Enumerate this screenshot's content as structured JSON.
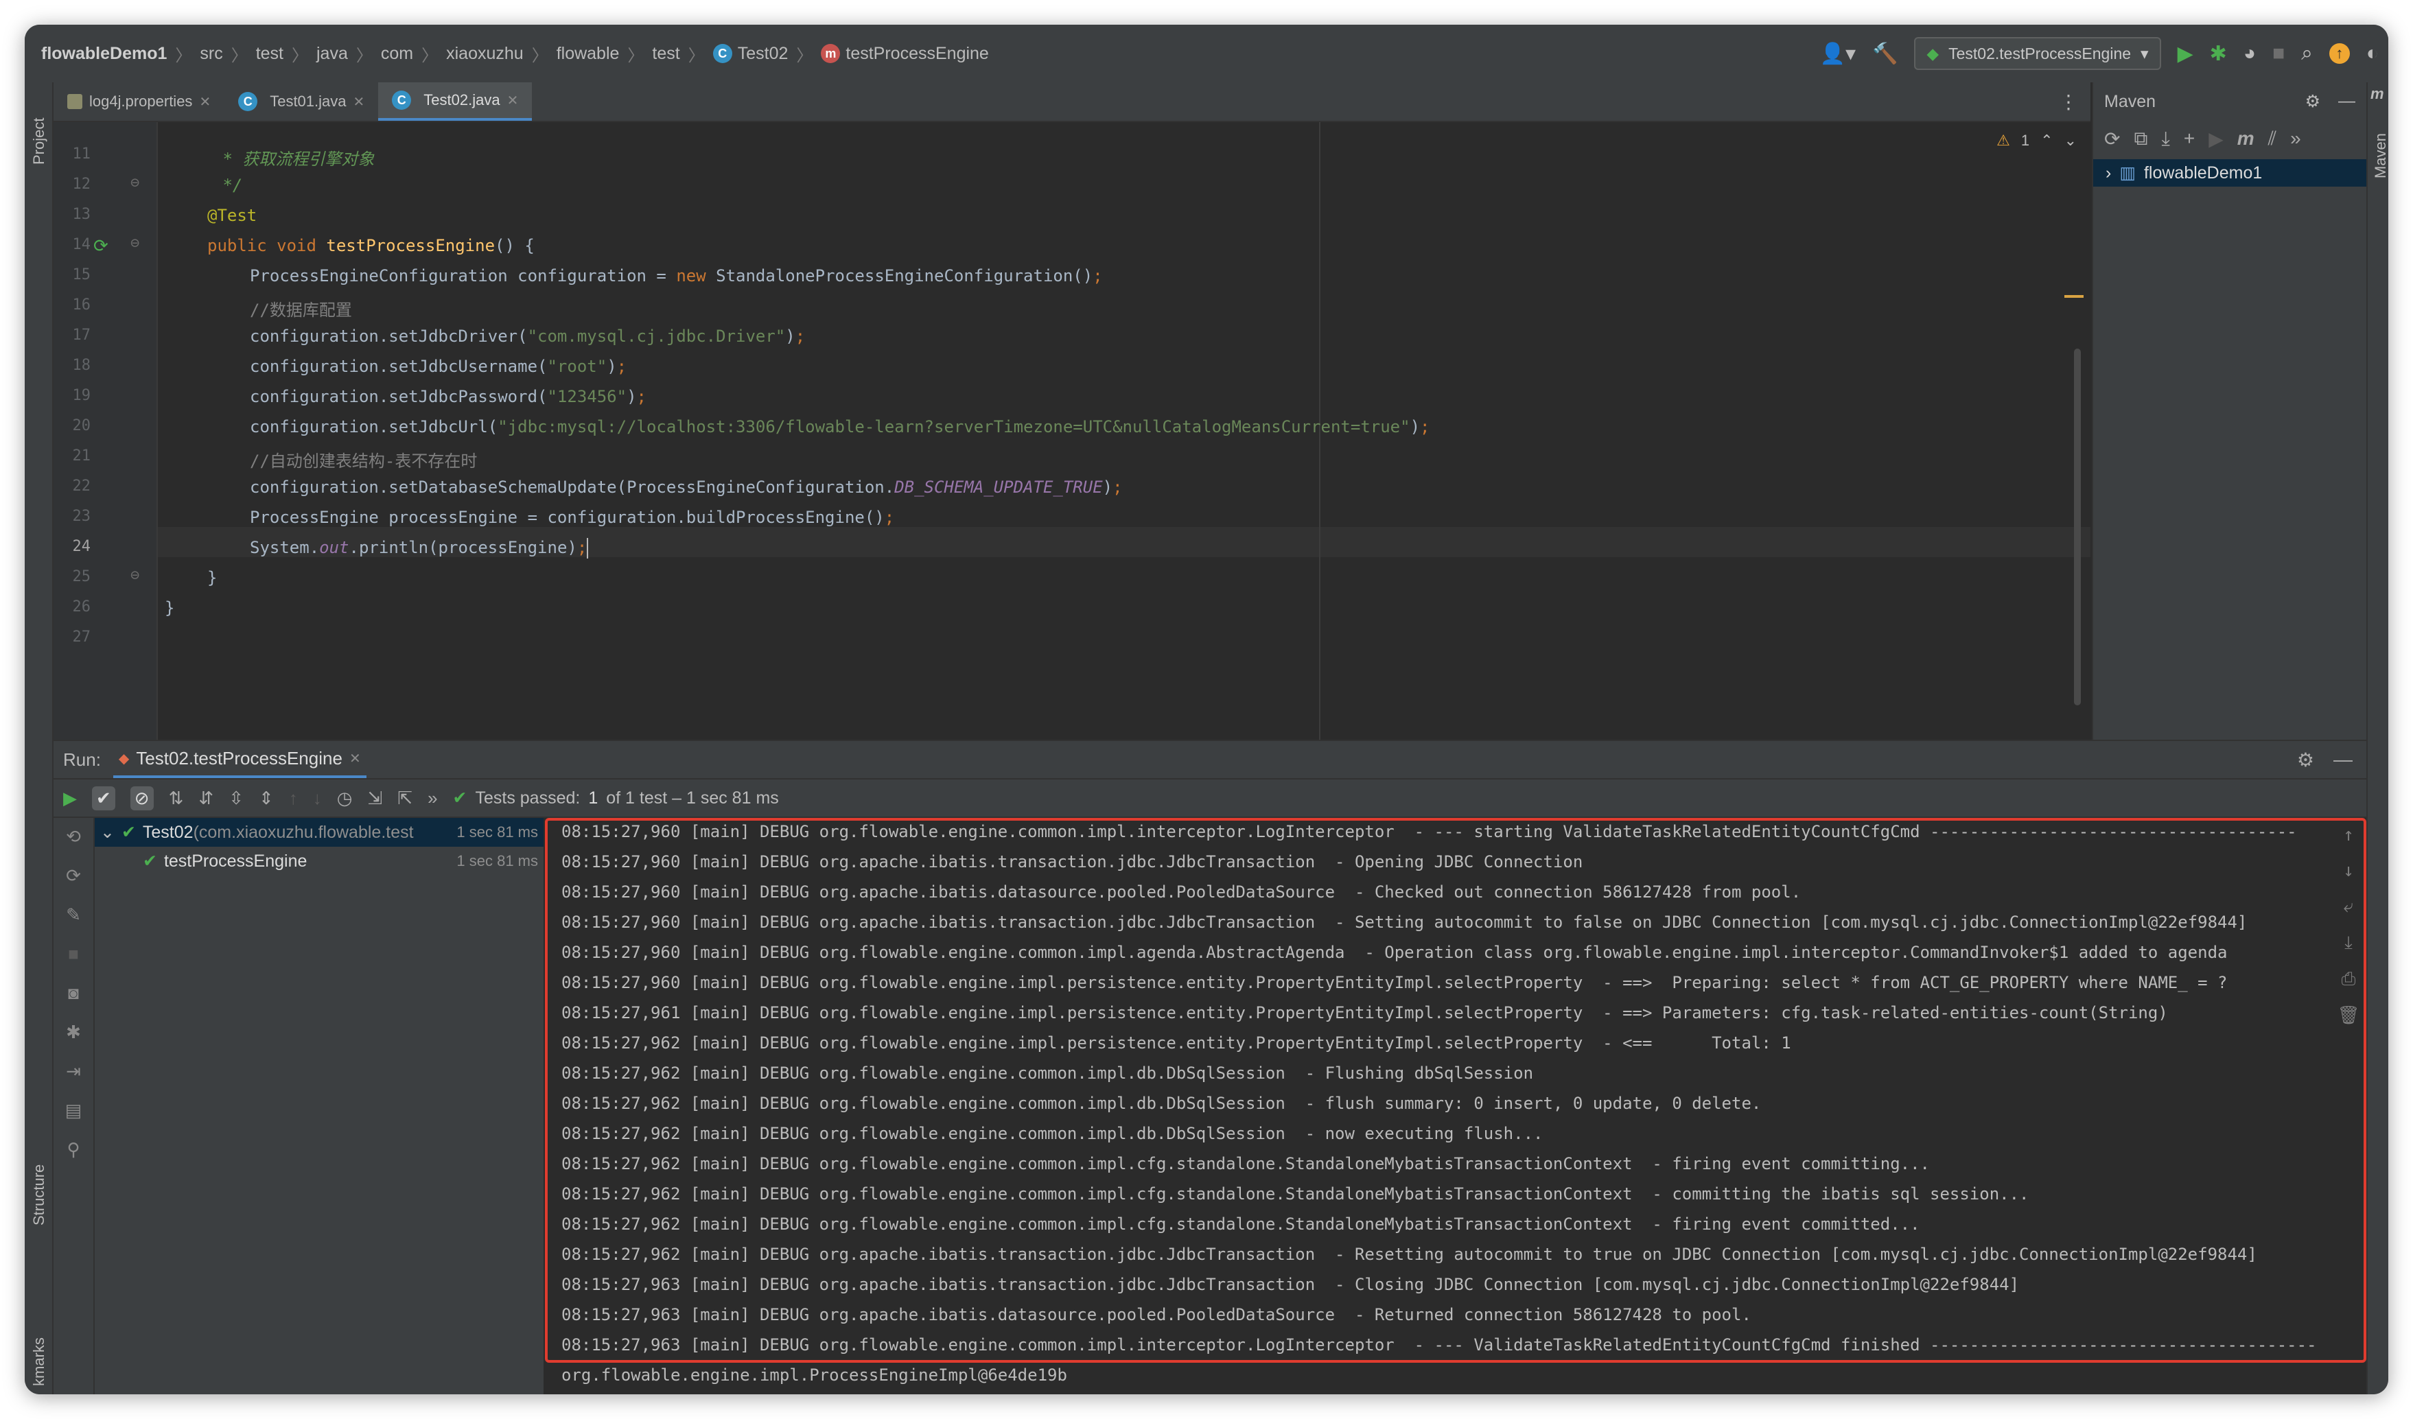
{
  "breadcrumbs": [
    "flowableDemo1",
    "src",
    "test",
    "java",
    "com",
    "xiaoxuzhu",
    "flowable",
    "test",
    "Test02",
    "testProcessEngine"
  ],
  "run_config": "Test02.testProcessEngine",
  "tabs": [
    {
      "label": "log4j.properties"
    },
    {
      "label": "Test01.java"
    },
    {
      "label": "Test02.java"
    }
  ],
  "side_labels": {
    "project": "Project",
    "structure": "Structure",
    "bookmarks": "kmarks",
    "maven": "Maven",
    "maven_strip": "m"
  },
  "editor": {
    "warning_count": "1",
    "line_numbers": [
      "11",
      "12",
      "13",
      "14",
      "15",
      "16",
      "17",
      "18",
      "19",
      "20",
      "21",
      "22",
      "23",
      "24",
      "25",
      "26",
      "27"
    ],
    "current_line": "24"
  },
  "maven": {
    "title": "Maven",
    "project": "flowableDemo1"
  },
  "run": {
    "label": "Run:",
    "tab": "Test02.testProcessEngine",
    "status_prefix": "Tests passed:",
    "status_count": "1",
    "status_suffix": "of 1 test – 1 sec 81 ms",
    "tree": [
      {
        "name": "Test02",
        "pkg": " (com.xiaoxuzhu.flowable.test",
        "time": "1 sec 81 ms"
      },
      {
        "name": "testProcessEngine",
        "time": "1 sec 81 ms"
      }
    ]
  },
  "console_lines": [
    "08:15:27,960 [main] DEBUG org.flowable.engine.common.impl.interceptor.LogInterceptor  - --- starting ValidateTaskRelatedEntityCountCfgCmd -------------------------------------",
    "08:15:27,960 [main] DEBUG org.apache.ibatis.transaction.jdbc.JdbcTransaction  - Opening JDBC Connection",
    "08:15:27,960 [main] DEBUG org.apache.ibatis.datasource.pooled.PooledDataSource  - Checked out connection 586127428 from pool.",
    "08:15:27,960 [main] DEBUG org.apache.ibatis.transaction.jdbc.JdbcTransaction  - Setting autocommit to false on JDBC Connection [com.mysql.cj.jdbc.ConnectionImpl@22ef9844]",
    "08:15:27,960 [main] DEBUG org.flowable.engine.common.impl.agenda.AbstractAgenda  - Operation class org.flowable.engine.impl.interceptor.CommandInvoker$1 added to agenda",
    "08:15:27,960 [main] DEBUG org.flowable.engine.impl.persistence.entity.PropertyEntityImpl.selectProperty  - ==>  Preparing: select * from ACT_GE_PROPERTY where NAME_ = ?",
    "08:15:27,961 [main] DEBUG org.flowable.engine.impl.persistence.entity.PropertyEntityImpl.selectProperty  - ==> Parameters: cfg.task-related-entities-count(String)",
    "08:15:27,962 [main] DEBUG org.flowable.engine.impl.persistence.entity.PropertyEntityImpl.selectProperty  - <==      Total: 1",
    "08:15:27,962 [main] DEBUG org.flowable.engine.common.impl.db.DbSqlSession  - Flushing dbSqlSession",
    "08:15:27,962 [main] DEBUG org.flowable.engine.common.impl.db.DbSqlSession  - flush summary: 0 insert, 0 update, 0 delete.",
    "08:15:27,962 [main] DEBUG org.flowable.engine.common.impl.db.DbSqlSession  - now executing flush...",
    "08:15:27,962 [main] DEBUG org.flowable.engine.common.impl.cfg.standalone.StandaloneMybatisTransactionContext  - firing event committing...",
    "08:15:27,962 [main] DEBUG org.flowable.engine.common.impl.cfg.standalone.StandaloneMybatisTransactionContext  - committing the ibatis sql session...",
    "08:15:27,962 [main] DEBUG org.flowable.engine.common.impl.cfg.standalone.StandaloneMybatisTransactionContext  - firing event committed...",
    "08:15:27,962 [main] DEBUG org.apache.ibatis.transaction.jdbc.JdbcTransaction  - Resetting autocommit to true on JDBC Connection [com.mysql.cj.jdbc.ConnectionImpl@22ef9844]",
    "08:15:27,963 [main] DEBUG org.apache.ibatis.transaction.jdbc.JdbcTransaction  - Closing JDBC Connection [com.mysql.cj.jdbc.ConnectionImpl@22ef9844]",
    "08:15:27,963 [main] DEBUG org.apache.ibatis.datasource.pooled.PooledDataSource  - Returned connection 586127428 to pool.",
    "08:15:27,963 [main] DEBUG org.flowable.engine.common.impl.interceptor.LogInterceptor  - --- ValidateTaskRelatedEntityCountCfgCmd finished ---------------------------------------",
    "org.flowable.engine.impl.ProcessEngineImpl@6e4de19b"
  ],
  "code": {
    "c11": " * 获取流程引擎对象",
    "c12": " */",
    "c13": "@Test",
    "c14_kw": "public void ",
    "c14_fn": "testProcessEngine",
    "c14_rest": "() {",
    "c15_a": "ProcessEngineConfiguration configuration = ",
    "c15_kw": "new ",
    "c15_b": "StandaloneProcessEngineConfiguration()",
    "c16": "//数据库配置",
    "c17_a": "configuration.setJdbcDriver(",
    "c17_s": "\"com.mysql.cj.jdbc.Driver\"",
    "c18_a": "configuration.setJdbcUsername(",
    "c18_s": "\"root\"",
    "c19_a": "configuration.setJdbcPassword(",
    "c19_s": "\"123456\"",
    "c20_a": "configuration.setJdbcUrl(",
    "c20_s": "\"jdbc:mysql://localhost:3306/flowable-learn?serverTimezone=UTC&nullCatalogMeansCurrent=true\"",
    "c21": "//自动创建表结构-表不存在时",
    "c22_a": "configuration.setDatabaseSchemaUpdate(ProcessEngineConfiguration.",
    "c22_f": "DB_SCHEMA_UPDATE_TRUE",
    "c23": "ProcessEngine processEngine = configuration.buildProcessEngine()",
    "c24_a": "System.",
    "c24_f": "out",
    "c24_b": ".println(processEngine)",
    "semi": ";",
    "close": ")",
    "c25": "}",
    "c26": "}"
  }
}
